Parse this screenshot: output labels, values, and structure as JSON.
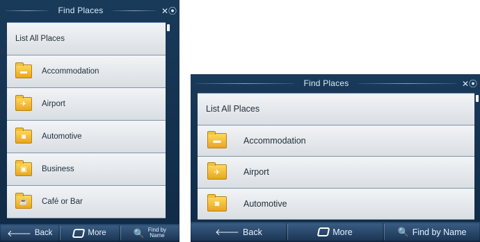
{
  "header": {
    "title": "Find Places"
  },
  "list": {
    "top_item": "List All Places",
    "categories": [
      {
        "label": "Accommodation",
        "icon": "bed-icon"
      },
      {
        "label": "Airport",
        "icon": "airplane-icon"
      },
      {
        "label": "Automotive",
        "icon": "car-icon"
      },
      {
        "label": "Business",
        "icon": "briefcase-icon"
      },
      {
        "label": "Café or Bar",
        "icon": "cup-icon"
      }
    ]
  },
  "toolbar": {
    "back_label": "Back",
    "more_label": "More",
    "find_label": "Find by Name",
    "find_label_line1": "Find by",
    "find_label_line2": "Name"
  },
  "colors": {
    "accent_folder": "#e8a61d",
    "panel": "#0d2744"
  }
}
